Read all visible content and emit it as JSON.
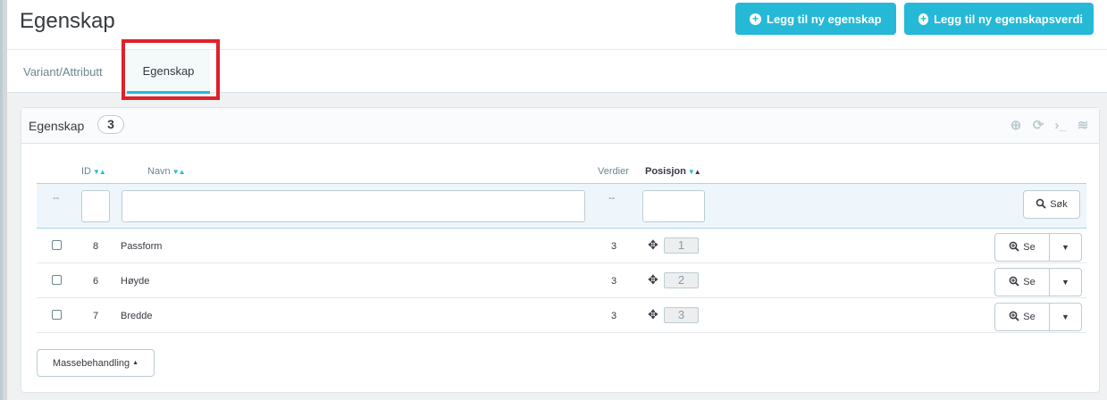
{
  "header": {
    "title": "Egenskap",
    "buttons": {
      "add_property": "Legg til ny egenskap",
      "add_property_value": "Legg til ny egenskapsverdi"
    },
    "tabs": [
      {
        "label": "Variant/Attributt",
        "active": false
      },
      {
        "label": "Egenskap",
        "active": true
      }
    ]
  },
  "panel": {
    "title": "Egenskap",
    "count": "3",
    "columns": {
      "id": "ID",
      "name": "Navn",
      "values": "Verdier",
      "position": "Posisjon"
    },
    "filter": {
      "dash_left": "--",
      "dash_values": "--",
      "id_value": "",
      "name_value": "",
      "position_value": "",
      "search_label": "Søk"
    },
    "rows": [
      {
        "id": "8",
        "name": "Passform",
        "values": "3",
        "position": "1",
        "view_label": "Se"
      },
      {
        "id": "6",
        "name": "Høyde",
        "values": "3",
        "position": "2",
        "view_label": "Se"
      },
      {
        "id": "7",
        "name": "Bredde",
        "values": "3",
        "position": "3",
        "view_label": "Se"
      }
    ],
    "bulk_label": "Massebehandling"
  },
  "colors": {
    "accent": "#25b9d7",
    "highlight": "#e0202a"
  }
}
